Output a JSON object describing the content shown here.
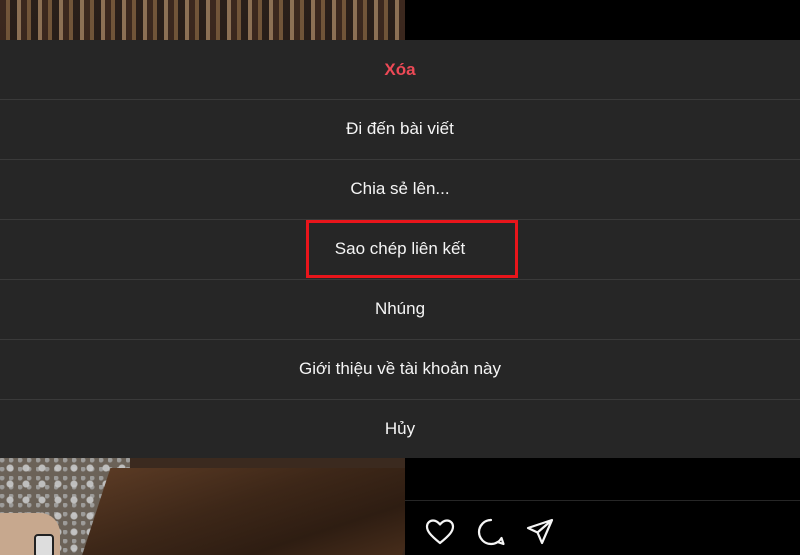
{
  "menu": {
    "items": [
      {
        "label": "Xóa",
        "style": "danger",
        "color": "#ed4956"
      },
      {
        "label": "Đi đến bài viết"
      },
      {
        "label": "Chia sẻ lên..."
      },
      {
        "label": "Sao chép liên kết",
        "highlighted": true
      },
      {
        "label": "Nhúng"
      },
      {
        "label": "Giới thiệu về tài khoản này"
      },
      {
        "label": "Hủy"
      }
    ]
  },
  "highlight": {
    "color": "#e8151b",
    "target": "Sao chép liên kết"
  },
  "post_actions": {
    "icons": [
      "heart-icon",
      "comment-icon",
      "share-icon"
    ]
  },
  "colors": {
    "sheet_background": "#262626",
    "text": "#f5f5f5",
    "separator": "#3a3a3a"
  }
}
